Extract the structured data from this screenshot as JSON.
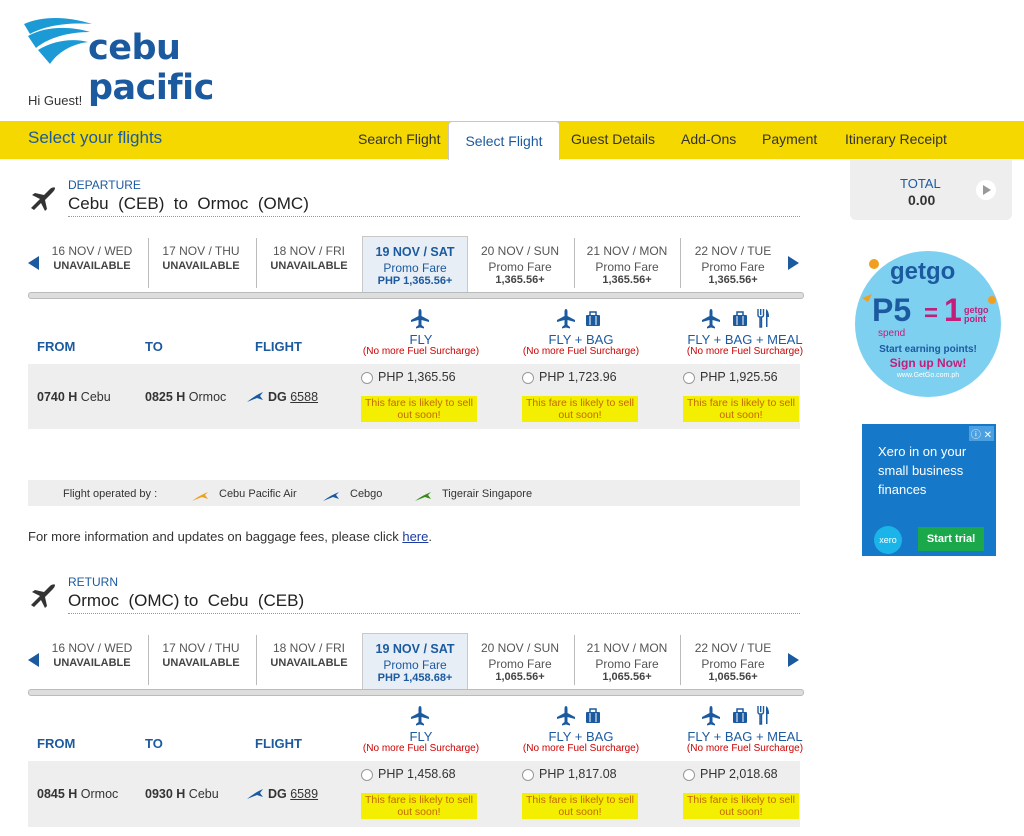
{
  "brand": {
    "name": "cebu pacific"
  },
  "greeting": "Hi Guest!",
  "nav": {
    "title": "Select your flights",
    "steps": [
      "Search Flight",
      "Select Flight",
      "Guest Details",
      "Add-Ons",
      "Payment",
      "Itinerary Receipt"
    ],
    "active": "Select Flight"
  },
  "total": {
    "label": "TOTAL",
    "value": "0.00"
  },
  "departure": {
    "label": "DEPARTURE",
    "route": "Cebu  (CEB)  to  Ormoc  (OMC)",
    "dates": [
      {
        "date": "16 NOV / WED",
        "l2": "UNAVAILABLE",
        "l3": ""
      },
      {
        "date": "17 NOV / THU",
        "l2": "UNAVAILABLE",
        "l3": ""
      },
      {
        "date": "18 NOV / FRI",
        "l2": "UNAVAILABLE",
        "l3": ""
      },
      {
        "date": "19 NOV / SAT",
        "l2": "Promo Fare",
        "l3": "PHP 1,365.56+"
      },
      {
        "date": "20 NOV / SUN",
        "l2": "Promo Fare",
        "l3": "1,365.56+"
      },
      {
        "date": "21 NOV / MON",
        "l2": "Promo Fare",
        "l3": "1,365.56+"
      },
      {
        "date": "22 NOV / TUE",
        "l2": "Promo Fare",
        "l3": "1,365.56+"
      }
    ],
    "headers": {
      "from": "FROM",
      "to": "TO",
      "flight": "FLIGHT"
    },
    "fares": [
      {
        "name": "FLY",
        "note": "(No more Fuel Surcharge)"
      },
      {
        "name": "FLY + BAG",
        "note": "(No more Fuel Surcharge)"
      },
      {
        "name": "FLY + BAG + MEAL",
        "note": "(No more Fuel Surcharge)"
      }
    ],
    "flight": {
      "dep_time": "0740 H",
      "dep_city": "Cebu",
      "arr_time": "0825 H",
      "arr_city": "Ormoc",
      "carrier": "DG",
      "number": "6588",
      "prices": [
        "PHP 1,365.56",
        "PHP 1,723.96",
        "PHP 1,925.56"
      ],
      "warning": "This fare is likely to sell out soon!"
    }
  },
  "operated": {
    "label": "Flight operated by :",
    "carriers": [
      "Cebu Pacific Air",
      "Cebgo",
      "Tigerair Singapore"
    ],
    "colors": [
      "#f0a020",
      "#1c5aa0",
      "#3a8a1a"
    ]
  },
  "baggage_info": {
    "text": "For more information and updates on baggage fees, please click ",
    "link": "here",
    "end": "."
  },
  "return": {
    "label": "RETURN",
    "route": "Ormoc  (OMC) to  Cebu  (CEB)",
    "dates": [
      {
        "date": "16 NOV / WED",
        "l2": "UNAVAILABLE",
        "l3": ""
      },
      {
        "date": "17 NOV / THU",
        "l2": "UNAVAILABLE",
        "l3": ""
      },
      {
        "date": "18 NOV / FRI",
        "l2": "UNAVAILABLE",
        "l3": ""
      },
      {
        "date": "19 NOV / SAT",
        "l2": "Promo Fare",
        "l3": "PHP 1,458.68+"
      },
      {
        "date": "20 NOV / SUN",
        "l2": "Promo Fare",
        "l3": "1,065.56+"
      },
      {
        "date": "21 NOV / MON",
        "l2": "Promo Fare",
        "l3": "1,065.56+"
      },
      {
        "date": "22 NOV / TUE",
        "l2": "Promo Fare",
        "l3": "1,065.56+"
      }
    ],
    "headers": {
      "from": "FROM",
      "to": "TO",
      "flight": "FLIGHT"
    },
    "fares": [
      {
        "name": "FLY",
        "note": "(No more Fuel Surcharge)"
      },
      {
        "name": "FLY + BAG",
        "note": "(No more Fuel Surcharge)"
      },
      {
        "name": "FLY + BAG + MEAL",
        "note": "(No more Fuel Surcharge)"
      }
    ],
    "flight": {
      "dep_time": "0845 H",
      "dep_city": "Ormoc",
      "arr_time": "0930 H",
      "arr_city": "Cebu",
      "carrier": "DG",
      "number": "6589",
      "prices": [
        "PHP 1,458.68",
        "PHP 1,817.08",
        "PHP 2,018.68"
      ],
      "warning": "This fare is likely to sell out soon!"
    }
  },
  "ads": {
    "getgo": {
      "brand": "getgo",
      "big": "P5",
      "spend": "spend",
      "equals": "=",
      "one": "1",
      "point": "getgo point",
      "line1": "Start earning points!",
      "line2": "Sign up Now!",
      "url": "www.GetGo.com.ph"
    },
    "xero": {
      "text": "Xero in on your small business finances",
      "logo": "xero",
      "cta": "Start trial"
    }
  }
}
